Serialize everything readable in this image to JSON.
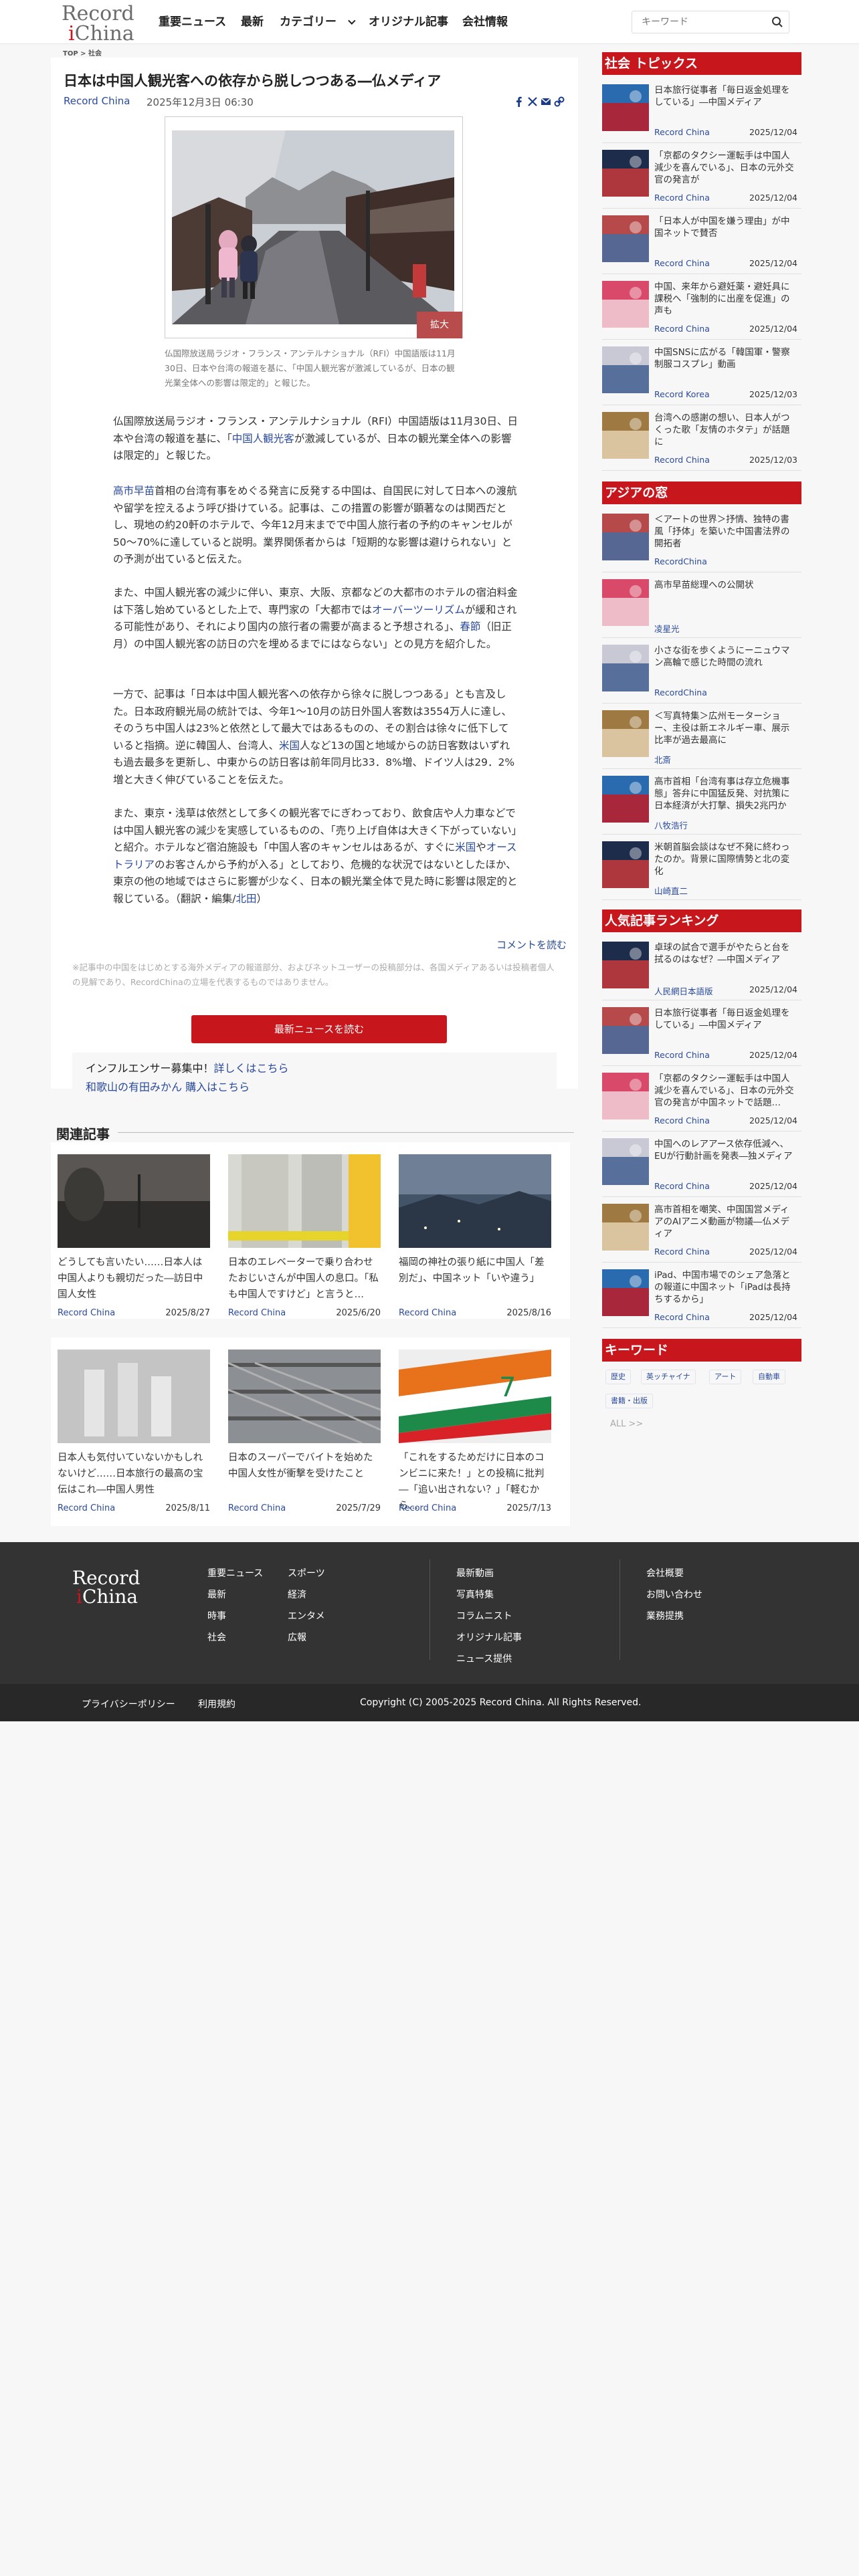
{
  "header": {
    "logo_line1": "Record",
    "logo_line2": "China",
    "nav": [
      "重要ニュース",
      "最新",
      "カテゴリー",
      "オリジナル記事",
      "会社情報"
    ],
    "search_placeholder": "キーワード"
  },
  "breadcrumb": [
    "TOP",
    "社会"
  ],
  "article": {
    "title": "日本は中国人観光客への依存から脱しつつある―仏メディア",
    "source": "Record China",
    "date": "2025年12月3日 06:30",
    "enlarge_label": "拡大",
    "caption": "仏国際放送局ラジオ・フランス・アンテルナショナル（RFI）中国語版は11月30日、日本や台湾の報道を基に、「中国人観光客が激減しているが、日本の観光業全体への影響は限定的」と報じた。",
    "paragraphs": [
      [
        "仏国際放送局ラジオ・フランス・アンテルナショナル（RFI）中国語版は11月30日、日本や台湾の報道を基に、「",
        "中国人観光客",
        "が激減しているが、日本の観光業全体への影響は限定的」と報じた。"
      ],
      [
        "",
        "高市早苗",
        "首相の台湾有事をめぐる発言に反発する中国は、自国民に対して日本への渡航や留学を控えるよう呼び掛けている。記事は、この措置の影響が顕著なのは関西だとし、現地の約20軒のホテルで、今年12月末までで中国人旅行者の予約のキャンセルが50〜70%に達していると説明。業界関係者からは「短期的な影響は避けられない」との予測が出ていると伝えた。"
      ],
      [
        "また、中国人観光客の減少に伴い、東京、大阪、京都などの大都市のホテルの宿泊料金は下落し始めているとした上で、専門家の「大都市では",
        "オーバーツーリズム",
        "が緩和される可能性があり、それにより国内の旅行者の需要が高まると予想される」、",
        "春節",
        "（旧正月）の中国人観光客の訪日の穴を埋めるまでにはならない」との見方を紹介した。"
      ],
      [
        "一方で、記事は「日本は中国人観光客への依存から徐々に脱しつつある」とも言及した。日本政府観光局の統計では、今年1〜10月の訪日外国人客数は3554万人に達し、そのうち中国人は23%と依然として最大ではあるものの、その割合は徐々に低下していると指摘。逆に韓国人、台湾人、",
        "米国",
        "人など13の国と地域からの訪日客数はいずれも過去最多を更新し、中東からの訪日客は前年同月比33．8%増、ドイツ人は29．2%増と大きく伸びていることを伝えた。"
      ],
      [
        "また、東京・浅草は依然として多くの観光客でにぎわっており、飲食店や人力車などでは中国人観光客の減少を実感しているものの、「売り上げ自体は大きく下がっていない」と紹介。ホテルなど宿泊施設も「中国人客のキャンセルはあるが、すぐに",
        "米国",
        "や",
        "オーストラリア",
        "のお客さんから予約が入る」としており、危機的な状況ではないとしたほか、東京の他の地域ではさらに影響が少なく、日本の観光業全体で見た時に影響は限定的と報じている。（翻訳・編集/",
        "北田",
        "）"
      ]
    ],
    "comment_link": "コメントを読む",
    "notice": "※記事中の中国をはじめとする海外メディアの報道部分、およびネットユーザーの投稿部分は、各国メディアあるいは投稿者個人の見解であり、RecordChinaの立場を代表するものではありません。",
    "read_more": "最新ニュースを読む",
    "promo_line1": "インフルエンサー募集中！",
    "promo_link1": "詳しくはこちら",
    "promo_line2": "和歌山の有田みかん 購入はこちら"
  },
  "related": {
    "heading": "関連記事",
    "items": [
      {
        "title": "どうしても言いたい……日本人は中国人よりも親切だった―訪日中国人女性",
        "source": "Record China",
        "date": "2025/8/27"
      },
      {
        "title": "日本のエレベーターで乗り合わせたおじいさんが中国人の息口。「私も中国人ですけど」と言うと…",
        "source": "Record China",
        "date": "2025/6/20"
      },
      {
        "title": "福岡の神社の張り紙に中国人「差別だ」、中国ネット「いや違う」",
        "source": "Record China",
        "date": "2025/8/16"
      },
      {
        "title": "日本人も気付いていないかもしれないけど……日本旅行の最高の宝伝はこれ―中国人男性",
        "source": "Record China",
        "date": "2025/8/11"
      },
      {
        "title": "日本のスーパーでバイトを始めた中国人女性が衝撃を受けたこと",
        "source": "Record China",
        "date": "2025/7/29"
      },
      {
        "title": "「これをするためだけに日本のコンビニに来た！」との投稿に批判―「追い出されない？」「軽むから…",
        "source": "Record China",
        "date": "2025/7/13"
      }
    ]
  },
  "sidebar": {
    "topics_heading": "社会 トピックス",
    "topics": [
      {
        "title": "日本旅行従事者「毎日返金処理をしている」―中国メディア",
        "source": "Record China",
        "date": "2025/12/04"
      },
      {
        "title": "「京都のタクシー運転手は中国人減少を喜んでいる」、日本の元外交官の発言が",
        "source": "Record China",
        "date": "2025/12/04"
      },
      {
        "title": "「日本人が中国を嫌う理由」が中国ネットで賛否",
        "source": "Record China",
        "date": "2025/12/04"
      },
      {
        "title": "中国、来年から避妊薬・避妊具に課税へ「強制的に出産を促進」の声も",
        "source": "Record China",
        "date": "2025/12/04"
      },
      {
        "title": "中国SNSに広がる「韓国軍・警察制服コスプレ」動画",
        "source": "Record Korea",
        "date": "2025/12/03"
      },
      {
        "title": "台湾への感謝の想い、日本人がつくった歌「友情のホタテ」が話題に",
        "source": "Record China",
        "date": "2025/12/03"
      }
    ],
    "asia_heading": "アジアの窓",
    "asia": [
      {
        "title": "＜アートの世界＞抒情、独特の書風「抒体」を築いた中国書法界の開拓者",
        "source": "RecordChina"
      },
      {
        "title": "高市早苗総理への公開状",
        "source": "凌星光"
      },
      {
        "title": "小さな街を歩くようにーニュウマン高輪で感じた時間の流れ",
        "source": "RecordChina"
      },
      {
        "title": "＜写真特集＞広州モーターショー、主役は新エネルギー車、展示比率が過去最高に",
        "source": "北斎"
      },
      {
        "title": "高市首相「台湾有事は存立危機事態」答弁に中国猛反発、対抗策に日本経済が大打撃、損失2兆円か",
        "source": "八牧浩行"
      },
      {
        "title": "米朝首脳会談はなぜ不発に終わったのか。背景に国際情勢と北の変化",
        "source": "山崎直二"
      }
    ],
    "ranking_heading": "人気記事ランキング",
    "ranking": [
      {
        "title": "卓球の試合で選手がやたらと台を拭るのはなぜ？―中国メディア",
        "source": "人民網日本語版",
        "date": "2025/12/04"
      },
      {
        "title": "日本旅行従事者「毎日返金処理をしている」―中国メディア",
        "source": "Record China",
        "date": "2025/12/04"
      },
      {
        "title": "「京都のタクシー運転手は中国人減少を喜んでいる」、日本の元外交官の発言が中国ネットで話題…",
        "source": "Record China",
        "date": "2025/12/04"
      },
      {
        "title": "中国へのレアアース依存低減へ、EUが行動計画を発表―独メディア",
        "source": "Record China",
        "date": "2025/12/04"
      },
      {
        "title": "高市首相を嘲笑、中国国営メディアのAIアニメ動画が物議―仏メディア",
        "source": "Record China",
        "date": "2025/12/04"
      },
      {
        "title": "iPad、中国市場でのシェア急落との報道に中国ネット「iPadは長持ちするから」",
        "source": "Record China",
        "date": "2025/12/04"
      }
    ],
    "keyword_heading": "キーワード",
    "keywords": [
      "歴史",
      "英ッチャイナ",
      "アート",
      "自動車",
      "書籍・出版"
    ],
    "all_label": "ALL"
  },
  "footer": {
    "col1": [
      "重要ニュース",
      "最新",
      "時事",
      "社会"
    ],
    "col2": [
      "スポーツ",
      "経済",
      "エンタメ",
      "広報"
    ],
    "col3": [
      "最新動画",
      "写真特集",
      "コラムニスト",
      "オリジナル記事",
      "ニュース提供"
    ],
    "col4": [
      "会社概要",
      "お問い合わせ",
      "業務提携"
    ],
    "privacy": "プライバシーポリシー",
    "terms": "利用規約",
    "copyright": "Copyright (C) 2005-2025 Record China. All Rights Reserved."
  },
  "colors": {
    "accent": "#c8161d",
    "link": "#2a4a9c",
    "footer": "#333333"
  }
}
